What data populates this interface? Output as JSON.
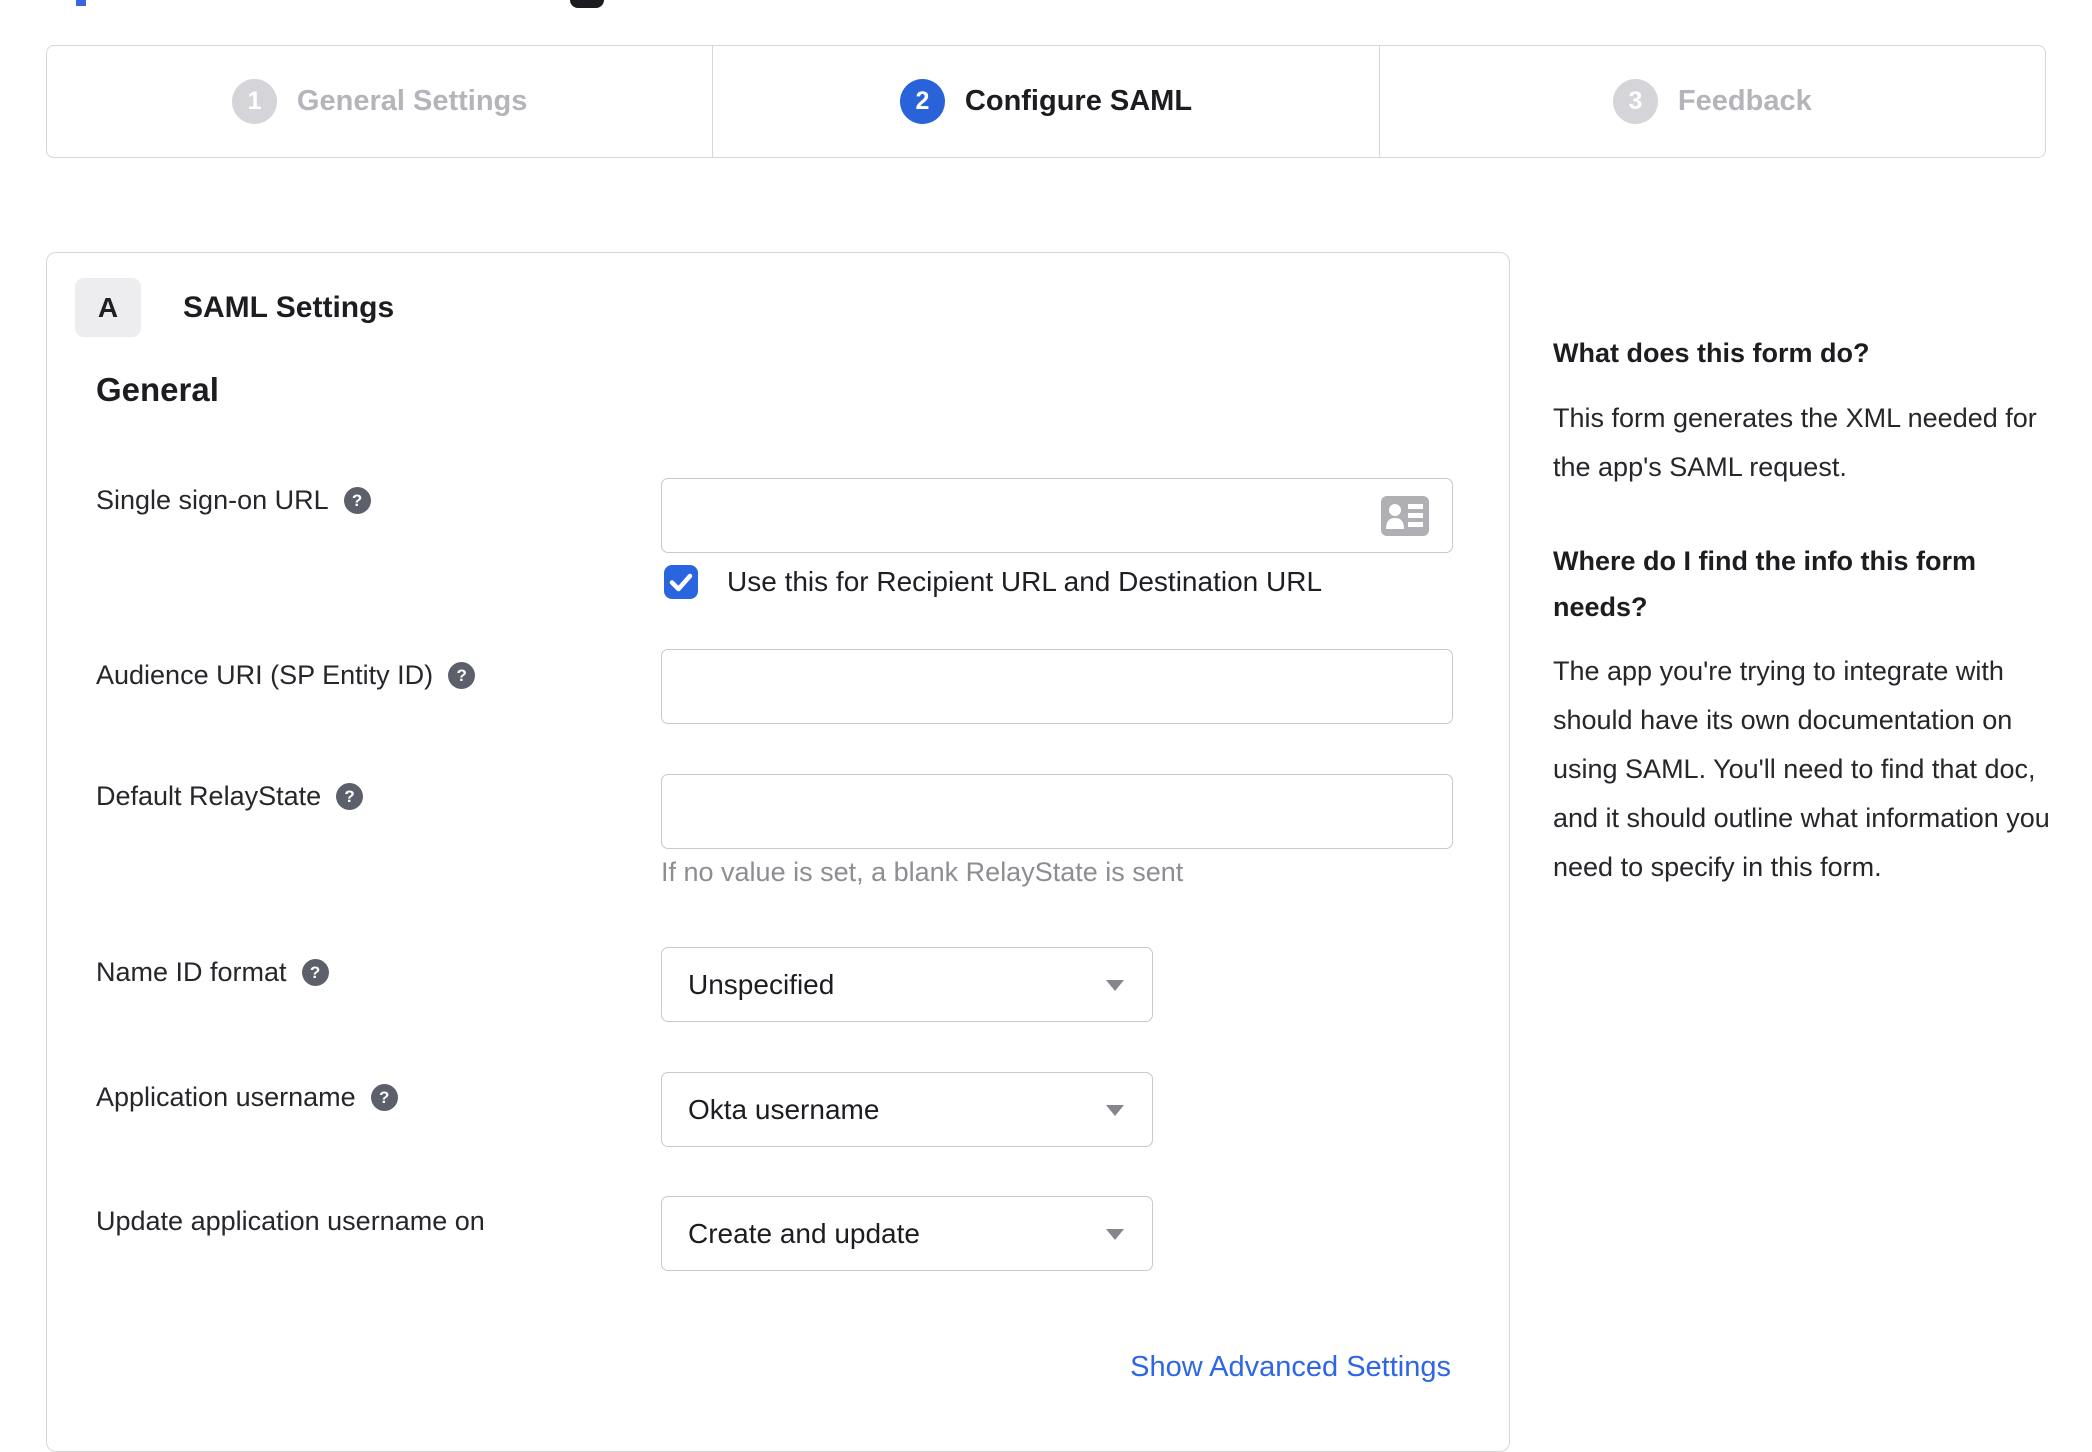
{
  "stepper": {
    "steps": [
      {
        "number": "1",
        "label": "General Settings",
        "state": "inactive"
      },
      {
        "number": "2",
        "label": "Configure SAML",
        "state": "active"
      },
      {
        "number": "3",
        "label": "Feedback",
        "state": "inactive"
      }
    ]
  },
  "panel": {
    "badge": "A",
    "title": "SAML Settings",
    "section_heading": "General",
    "fields": [
      {
        "label": "Single sign-on URL",
        "has_help": true,
        "type": "text",
        "value": "",
        "checkbox_label": "Use this for Recipient URL and Destination URL",
        "checkbox_checked": true
      },
      {
        "label": "Audience URI (SP Entity ID)",
        "has_help": true,
        "type": "text",
        "value": ""
      },
      {
        "label": "Default RelayState",
        "has_help": true,
        "type": "text",
        "value": "",
        "helper": "If no value is set, a blank RelayState is sent"
      },
      {
        "label": "Name ID format",
        "has_help": true,
        "type": "select",
        "value": "Unspecified"
      },
      {
        "label": "Application username",
        "has_help": true,
        "type": "select",
        "value": "Okta username"
      },
      {
        "label": "Update application username on",
        "has_help": false,
        "type": "select",
        "value": "Create and update"
      }
    ],
    "advanced_link": "Show Advanced Settings"
  },
  "sidebar": {
    "sections": [
      {
        "heading": "What does this form do?",
        "body": "This form generates the XML needed for the app's SAML request."
      },
      {
        "heading": "Where do I find the info this form needs?",
        "body": "The app you're trying to integrate with should have its own documentation on using SAML. You'll need to find that doc, and it should outline what information you need to specify in this form."
      }
    ]
  },
  "icons": {
    "help": "?"
  },
  "colors": {
    "accent_blue": "#2a62d9",
    "checkbox_blue": "#2a65e0",
    "link_blue": "#2e66e5",
    "inactive_step_gray": "#d4d4d9",
    "inactive_label_gray": "#b4b4bb",
    "border_gray": "#d7d7db",
    "input_border_gray": "#c9c9cd",
    "help_icon_gray": "#5b606b",
    "helper_text_gray": "#8d8d92"
  }
}
